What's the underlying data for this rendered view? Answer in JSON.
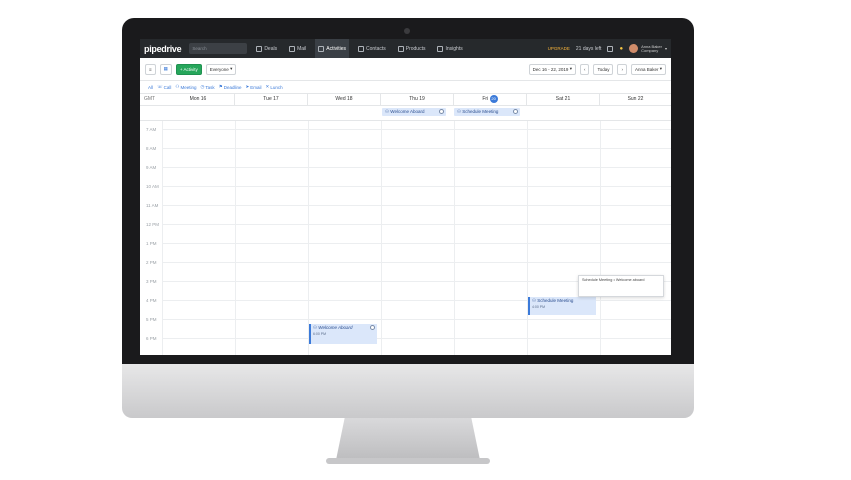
{
  "app": {
    "logo": "pipedrive",
    "search_placeholder": "Search",
    "nav": [
      {
        "label": "Deals",
        "active": false
      },
      {
        "label": "Mail",
        "active": false
      },
      {
        "label": "Activities",
        "active": true
      },
      {
        "label": "Contacts",
        "active": false
      },
      {
        "label": "Products",
        "active": false
      },
      {
        "label": "Insights",
        "active": false
      }
    ],
    "upgrade_label": "UPGRADE",
    "trial_text": "21 days left",
    "user_name": "Anna Baker",
    "user_company": "Company"
  },
  "toolbar": {
    "add_activity_label": "+ Activity",
    "filter_label": "Everyone",
    "date_range": "Dec 16 - 22, 2019",
    "today_label": "Today",
    "owner_label": "Anna Baker"
  },
  "filters": [
    {
      "label": "All",
      "icon": "list-icon"
    },
    {
      "label": "Call",
      "icon": "phone-icon"
    },
    {
      "label": "Meeting",
      "icon": "people-icon"
    },
    {
      "label": "Task",
      "icon": "clock-icon"
    },
    {
      "label": "Deadline",
      "icon": "flag-icon"
    },
    {
      "label": "Email",
      "icon": "send-icon"
    },
    {
      "label": "Lunch",
      "icon": "fork-icon"
    }
  ],
  "calendar": {
    "timezone": "GMT",
    "days": [
      {
        "label": "Mon 16"
      },
      {
        "label": "Tue 17"
      },
      {
        "label": "Wed 18"
      },
      {
        "label": "Thu 19"
      },
      {
        "label": "Fri",
        "today_num": "20"
      },
      {
        "label": "Sat 21"
      },
      {
        "label": "Sun 22"
      }
    ],
    "hours": [
      "7 AM",
      "8 AM",
      "9 AM",
      "10 AM",
      "11 AM",
      "12 PM",
      "1 PM",
      "2 PM",
      "3 PM",
      "4 PM",
      "5 PM",
      "6 PM"
    ],
    "allday_events": [
      {
        "title": "Welcome Aboard"
      },
      {
        "title": "Schedule Meeting"
      }
    ],
    "timed_events": [
      {
        "title": "Schedule Meeting",
        "time": "4:00 PM"
      },
      {
        "title": "Welcome Aboard",
        "time": "6:00 PM"
      }
    ],
    "tooltip_text": "Schedule Meeting • Welcome aboard"
  }
}
